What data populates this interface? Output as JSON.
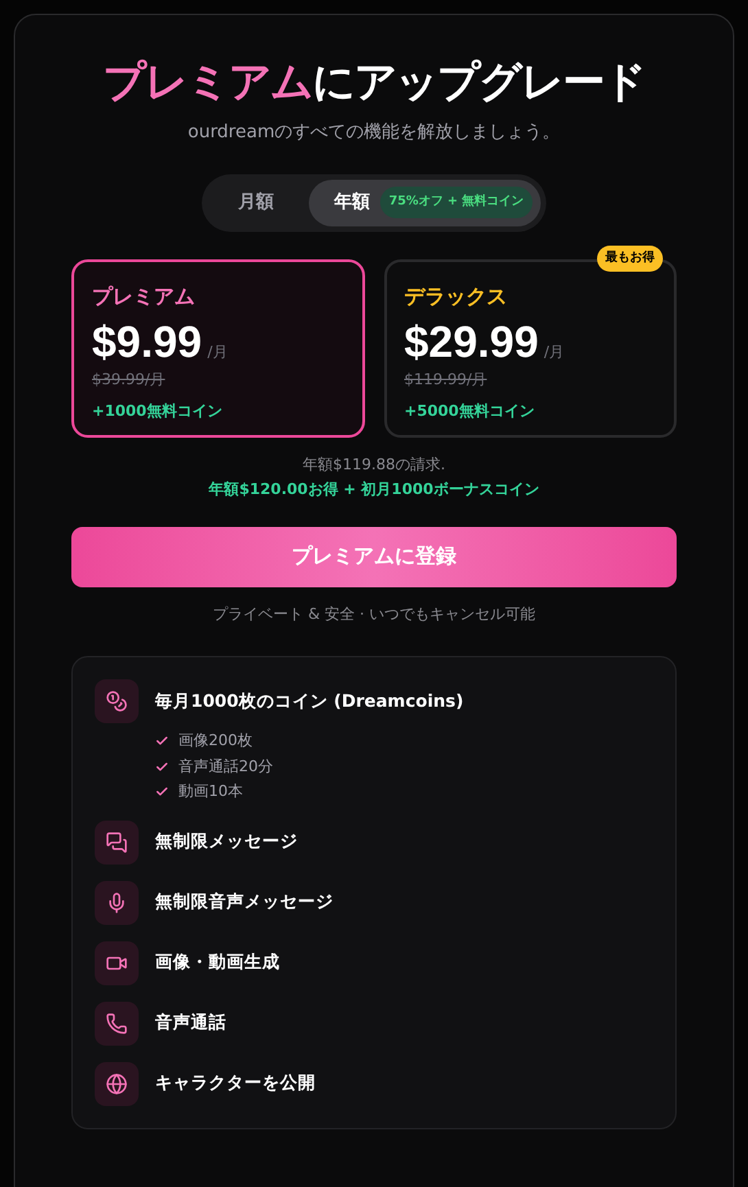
{
  "title": {
    "highlight": "プレミアム",
    "rest": "にアップグレード"
  },
  "subtitle": "ourdreamのすべての機能を解放しましょう。",
  "billing_tabs": [
    {
      "label": "月額",
      "selected": false
    },
    {
      "label": "年額",
      "selected": true,
      "badge": "75%オフ + 無料コイン"
    }
  ],
  "plans": [
    {
      "name": "プレミアム",
      "color": "#f472b6",
      "price": "$9.99",
      "unit": "/月",
      "original_price": "$39.99/月",
      "coins": "+1000無料コイン",
      "selected": true
    },
    {
      "name": "デラックス",
      "color": "#fbbf24",
      "price": "$29.99",
      "unit": "/月",
      "original_price": "$119.99/月",
      "coins": "+5000無料コイン",
      "selected": false,
      "badge": "最もお得"
    }
  ],
  "billing_note": "年額$119.88の請求.",
  "savings_note": "年額$120.00お得 + 初月1000ボーナスコイン",
  "subscribe_button": "プレミアムに登録",
  "assurance": "プライベート & 安全 · いつでもキャンセル可能",
  "features": [
    {
      "kind": "coins",
      "label": "毎月1000枚のコイン (Dreamcoins)",
      "details": [
        "画像200枚",
        "音声通話20分",
        "動画10本"
      ]
    },
    {
      "kind": "chat",
      "label": "無制限メッセージ"
    },
    {
      "kind": "mic",
      "label": "無制限音声メッセージ"
    },
    {
      "kind": "video",
      "label": "画像・動画生成"
    },
    {
      "kind": "phone",
      "label": "音声通話"
    },
    {
      "kind": "globe",
      "label": "キャラクターを公開"
    }
  ]
}
